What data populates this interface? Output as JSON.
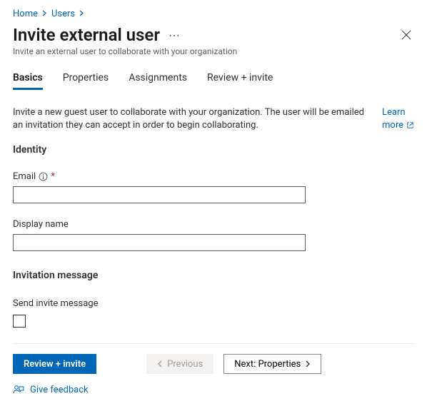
{
  "breadcrumb": {
    "home": "Home",
    "users": "Users"
  },
  "title": "Invite external user",
  "subtitle": "Invite an external user to collaborate with your organization",
  "tabs": {
    "basics": "Basics",
    "properties": "Properties",
    "assignments": "Assignments",
    "review": "Review + invite"
  },
  "description": "Invite a new guest user to collaborate with your organization. The user will be emailed an invitation they can accept in order to begin collaborating.",
  "learn_more_line1": "Learn",
  "learn_more_line2": "more",
  "identity_heading": "Identity",
  "email_label": "Email",
  "display_name_label": "Display name",
  "invitation_heading": "Invitation message",
  "send_invite_label": "Send invite message",
  "buttons": {
    "review_invite": "Review + invite",
    "previous": "Previous",
    "next": "Next: Properties"
  },
  "feedback": "Give feedback"
}
